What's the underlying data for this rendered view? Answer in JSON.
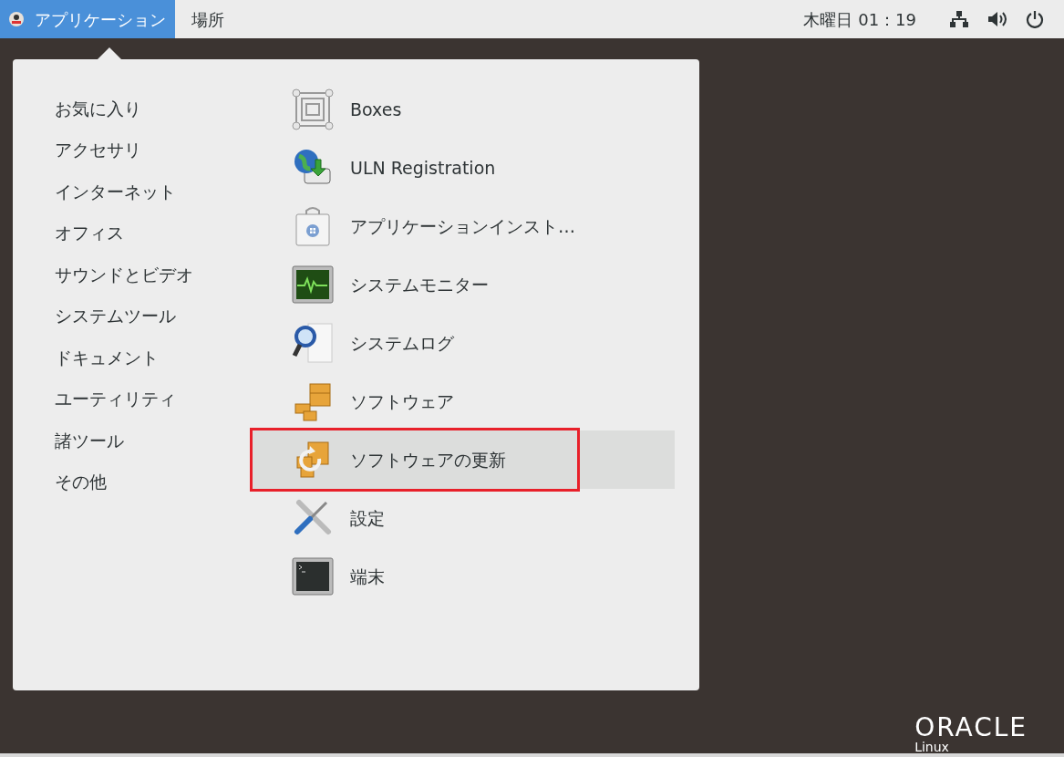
{
  "top_bar": {
    "menus": [
      {
        "label": "アプリケーション",
        "selected": true
      },
      {
        "label": "場所",
        "selected": false
      }
    ],
    "clock": "木曜日 01：19"
  },
  "menu": {
    "categories": [
      {
        "label": "お気に入り"
      },
      {
        "label": "アクセサリ"
      },
      {
        "label": "インターネット"
      },
      {
        "label": "オフィス"
      },
      {
        "label": "サウンドとビデオ"
      },
      {
        "label": "システムツール"
      },
      {
        "label": "ドキュメント"
      },
      {
        "label": "ユーティリティ"
      },
      {
        "label": "諸ツール"
      },
      {
        "label": "その他"
      }
    ],
    "apps": [
      {
        "label": "Boxes",
        "kind": "boxes",
        "selected": false
      },
      {
        "label": "ULN Registration",
        "kind": "globe",
        "selected": false
      },
      {
        "label": "アプリケーションインスト…",
        "kind": "bag",
        "selected": false
      },
      {
        "label": "システムモニター",
        "kind": "monitor",
        "selected": false
      },
      {
        "label": "システムログ",
        "kind": "log",
        "selected": false
      },
      {
        "label": "ソフトウェア",
        "kind": "packages",
        "selected": false
      },
      {
        "label": "ソフトウェアの更新",
        "kind": "update",
        "selected": true,
        "annotated": true
      },
      {
        "label": "設定",
        "kind": "tools",
        "selected": false
      },
      {
        "label": "端末",
        "kind": "terminal",
        "selected": false
      }
    ]
  },
  "logo": {
    "brand": "ORACLE",
    "product": "Linux"
  }
}
